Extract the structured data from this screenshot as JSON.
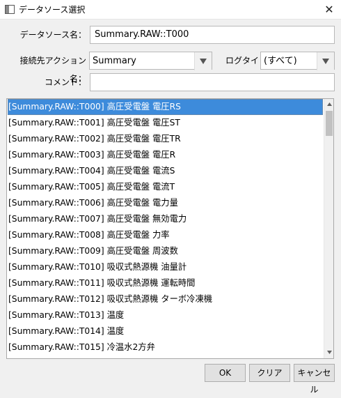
{
  "window": {
    "title": "データソース選択",
    "close_glyph": "✕"
  },
  "form": {
    "datasource_label": "データソース名：",
    "datasource_value": "Summary.RAW::T000",
    "action_label": "接続先アクション名：",
    "action_value": "Summary",
    "logtype_label": "ログタイプ：",
    "logtype_value": "(すべて)",
    "comment_label": "コメント：",
    "comment_value": ""
  },
  "list": {
    "items": [
      "[Summary.RAW::T000] 高圧受電盤 電圧RS",
      "[Summary.RAW::T001] 高圧受電盤 電圧ST",
      "[Summary.RAW::T002] 高圧受電盤 電圧TR",
      "[Summary.RAW::T003] 高圧受電盤 電圧R",
      "[Summary.RAW::T004] 高圧受電盤 電流S",
      "[Summary.RAW::T005] 高圧受電盤 電流T",
      "[Summary.RAW::T006] 高圧受電盤 電力量",
      "[Summary.RAW::T007] 高圧受電盤 無効電力",
      "[Summary.RAW::T008] 高圧受電盤 力率",
      "[Summary.RAW::T009] 高圧受電盤 周波数",
      "[Summary.RAW::T010] 吸収式熱源機 油量計",
      "[Summary.RAW::T011] 吸収式熱源機 運転時間",
      "[Summary.RAW::T012] 吸収式熱源機 ターボ冷凍機",
      "[Summary.RAW::T013] 温度",
      "[Summary.RAW::T014] 温度",
      "[Summary.RAW::T015] 冷温水2方弁"
    ],
    "selected_index": 0
  },
  "buttons": {
    "ok": "OK",
    "clear": "クリア",
    "cancel": "キャンセル"
  },
  "icons": {
    "window": "window-icon",
    "close": "close-icon",
    "dropdown": "chevron-down-icon"
  },
  "colors": {
    "selection": "#3d8bdb",
    "background": "#f0f0f0"
  }
}
